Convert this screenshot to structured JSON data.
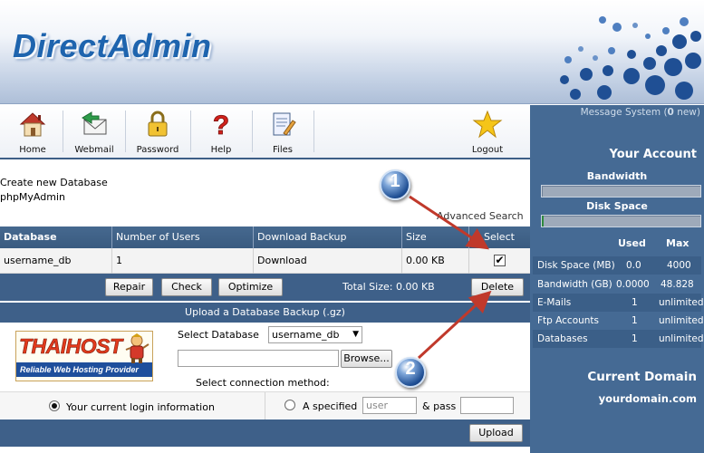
{
  "header": {
    "logo": "DirectAdmin"
  },
  "toolbar": {
    "items": [
      {
        "label": "Home"
      },
      {
        "label": "Webmail"
      },
      {
        "label": "Password"
      },
      {
        "label": "Help"
      },
      {
        "label": "Files"
      },
      {
        "label": "Logout"
      }
    ]
  },
  "sidebar": {
    "message_prefix": "Message System (",
    "message_count": "0",
    "message_suffix": " new)",
    "your_account": "Your Account",
    "bandwidth_label": "Bandwidth",
    "bandwidth_fraction": 0.0,
    "disk_label": "Disk Space",
    "disk_fraction": 0.01,
    "col_used": "Used",
    "col_max": "Max",
    "stats": [
      {
        "label": "Disk Space (MB)",
        "used": "0.0",
        "max": "4000"
      },
      {
        "label": "Bandwidth (GB)",
        "used": "0.0000",
        "max": "48.828"
      },
      {
        "label": "E-Mails",
        "used": "1",
        "max": "unlimited"
      },
      {
        "label": "Ftp Accounts",
        "used": "1",
        "max": "unlimited"
      },
      {
        "label": "Databases",
        "used": "1",
        "max": "unlimited"
      }
    ],
    "current_domain": "Current Domain",
    "domain": "yourdomain.com"
  },
  "main": {
    "create_db": "Create new Database",
    "phpmyadmin": "phpMyAdmin",
    "advanced_search": "Advanced Search",
    "columns": [
      "Database",
      "Number of Users",
      "Download Backup",
      "Size",
      "Select"
    ],
    "rows": [
      {
        "database": "username_db",
        "users": "1",
        "download": "Download",
        "size": "0.00 KB",
        "selected": true
      }
    ],
    "buttons": {
      "repair": "Repair",
      "check": "Check",
      "optimize": "Optimize",
      "delete": "Delete"
    },
    "total_size": "Total Size: 0.00 KB",
    "upload_header": "Upload a Database Backup (.gz)",
    "select_database_label": "Select Database",
    "select_database_value": "username_db",
    "browse": "Browse...",
    "connection_label": "Select connection method:",
    "option_current": "Your current login information",
    "option_specified": "A specified",
    "user_placeholder": "user",
    "pass_label": "& pass",
    "upload": "Upload"
  },
  "badge": {
    "brand": "THAIHOST",
    "tagline": "Reliable Web Hosting Provider"
  },
  "annotations": {
    "marker1": "1",
    "marker2": "2"
  },
  "colors": {
    "accent": "#1e64ae",
    "panel": "#456a94",
    "bar": "#3e6089",
    "arrow": "#c0392b"
  }
}
